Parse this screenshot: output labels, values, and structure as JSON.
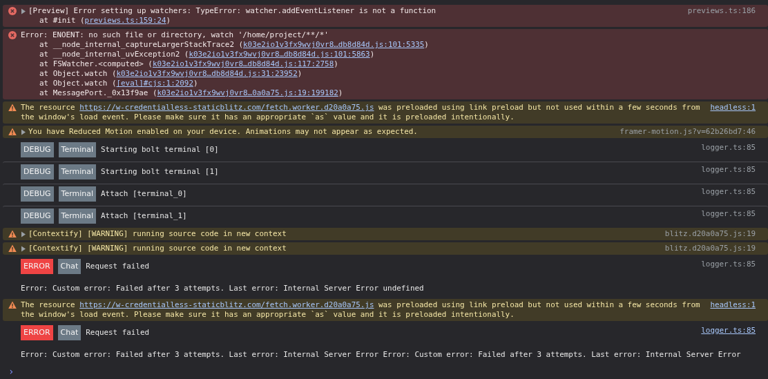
{
  "messages": [
    {
      "kind": "error",
      "expanded": false,
      "text": [
        [
          "[Preview] Error setting up watchers: TypeError: watcher.addEventListener is not a function"
        ]
      ],
      "stack": [
        [
          "at #init (",
          {
            "link": "previews.ts:159:24"
          },
          ")"
        ]
      ],
      "source": {
        "text": "previews.ts:186",
        "underlined": false
      }
    },
    {
      "kind": "error",
      "text": [
        [
          "Error: ENOENT: no such file or directory, watch '/home/project/**/*'"
        ]
      ],
      "stack": [
        [
          "at __node_internal_captureLargerStackTrace2 (",
          {
            "link": "k03e2io1v3fx9wvj0vr8…db8d84d.js:101:5335"
          },
          ")"
        ],
        [
          "at __node_internal_uvException2 (",
          {
            "link": "k03e2io1v3fx9wvj0vr8…db8d84d.js:101:5863"
          },
          ")"
        ],
        [
          "at FSWatcher.<computed> (",
          {
            "link": "k03e2io1v3fx9wvj0vr8…db8d84d.js:117:2758"
          },
          ")"
        ],
        [
          "at Object.watch (",
          {
            "link": "k03e2io1v3fx9wvj0vr8…db8d84d.js:31:23952"
          },
          ")"
        ],
        [
          "at Object.watch (",
          {
            "link": "[eval]#cjs:1:2092"
          },
          ")"
        ],
        [
          "at MessagePort._0x13f9ae (",
          {
            "link": "k03e2io1v3fx9wvj0vr8…0a0a75.js:19:199182"
          },
          ")"
        ]
      ]
    },
    {
      "kind": "warning",
      "text": [
        [
          "The resource ",
          {
            "link": "https://w-credentialless-staticblitz.com/fetch.worker.d20a0a75.js"
          },
          " was preloaded using link preload but not used within a few seconds from"
        ],
        [
          "the window's load event. Please make sure it has an appropriate `as` value and it is preloaded intentionally."
        ]
      ],
      "source": {
        "text": "headless:1",
        "underlined": true
      }
    },
    {
      "kind": "warning",
      "expanded": false,
      "text": [
        [
          "You have Reduced Motion enabled on your device. Animations may not appear as expected."
        ]
      ],
      "source": {
        "text": "framer-motion.js?v=62b26bd7:46",
        "underlined": false
      }
    },
    {
      "kind": "log",
      "badges": [
        {
          "label": "DEBUG",
          "color": "#6c7a86"
        },
        {
          "label": "Terminal",
          "color": "#6c7a86"
        }
      ],
      "text": "Starting bolt terminal [0]",
      "source": {
        "text": "logger.ts:85",
        "underlined": false
      }
    },
    {
      "kind": "log",
      "badges": [
        {
          "label": "DEBUG",
          "color": "#6c7a86"
        },
        {
          "label": "Terminal",
          "color": "#6c7a86"
        }
      ],
      "text": "Starting bolt terminal [1]",
      "source": {
        "text": "logger.ts:85",
        "underlined": false
      }
    },
    {
      "kind": "log",
      "badges": [
        {
          "label": "DEBUG",
          "color": "#6c7a86"
        },
        {
          "label": "Terminal",
          "color": "#6c7a86"
        }
      ],
      "text": "Attach [terminal_0]",
      "source": {
        "text": "logger.ts:85",
        "underlined": false
      }
    },
    {
      "kind": "log",
      "badges": [
        {
          "label": "DEBUG",
          "color": "#6c7a86"
        },
        {
          "label": "Terminal",
          "color": "#6c7a86"
        }
      ],
      "text": "Attach [terminal_1]",
      "source": {
        "text": "logger.ts:85",
        "underlined": false
      }
    },
    {
      "kind": "warning",
      "expanded": false,
      "text": [
        [
          "[Contextify] [WARNING] running source code in new context"
        ]
      ],
      "source": {
        "text": "blitz.d20a0a75.js:19",
        "underlined": false
      }
    },
    {
      "kind": "warning",
      "expanded": false,
      "text": [
        [
          "[Contextify] [WARNING] running source code in new context"
        ]
      ],
      "source": {
        "text": "blitz.d20a0a75.js:19",
        "underlined": false
      }
    },
    {
      "kind": "log",
      "badges": [
        {
          "label": "ERROR",
          "color": "#ef4444"
        },
        {
          "label": "Chat",
          "color": "#6c7a86"
        }
      ],
      "text": "Request failed",
      "detail": "Error: Custom error: Failed after 3 attempts. Last error: Internal Server Error undefined",
      "source": {
        "text": "logger.ts:85",
        "underlined": false
      }
    },
    {
      "kind": "warning",
      "text": [
        [
          "The resource ",
          {
            "link": "https://w-credentialless-staticblitz.com/fetch.worker.d20a0a75.js"
          },
          " was preloaded using link preload but not used within a few seconds from"
        ],
        [
          "the window's load event. Please make sure it has an appropriate `as` value and it is preloaded intentionally."
        ]
      ],
      "source": {
        "text": "headless:1",
        "underlined": true
      }
    },
    {
      "kind": "log",
      "badges": [
        {
          "label": "ERROR",
          "color": "#ef4444"
        },
        {
          "label": "Chat",
          "color": "#6c7a86"
        }
      ],
      "text": "Request failed",
      "detail": "Error: Custom error: Failed after 3 attempts. Last error: Internal Server Error Error: Custom error: Failed after 3 attempts. Last error: Internal Server Error",
      "source": {
        "text": "logger.ts:85",
        "underlined": true
      }
    }
  ],
  "prompt": "›"
}
